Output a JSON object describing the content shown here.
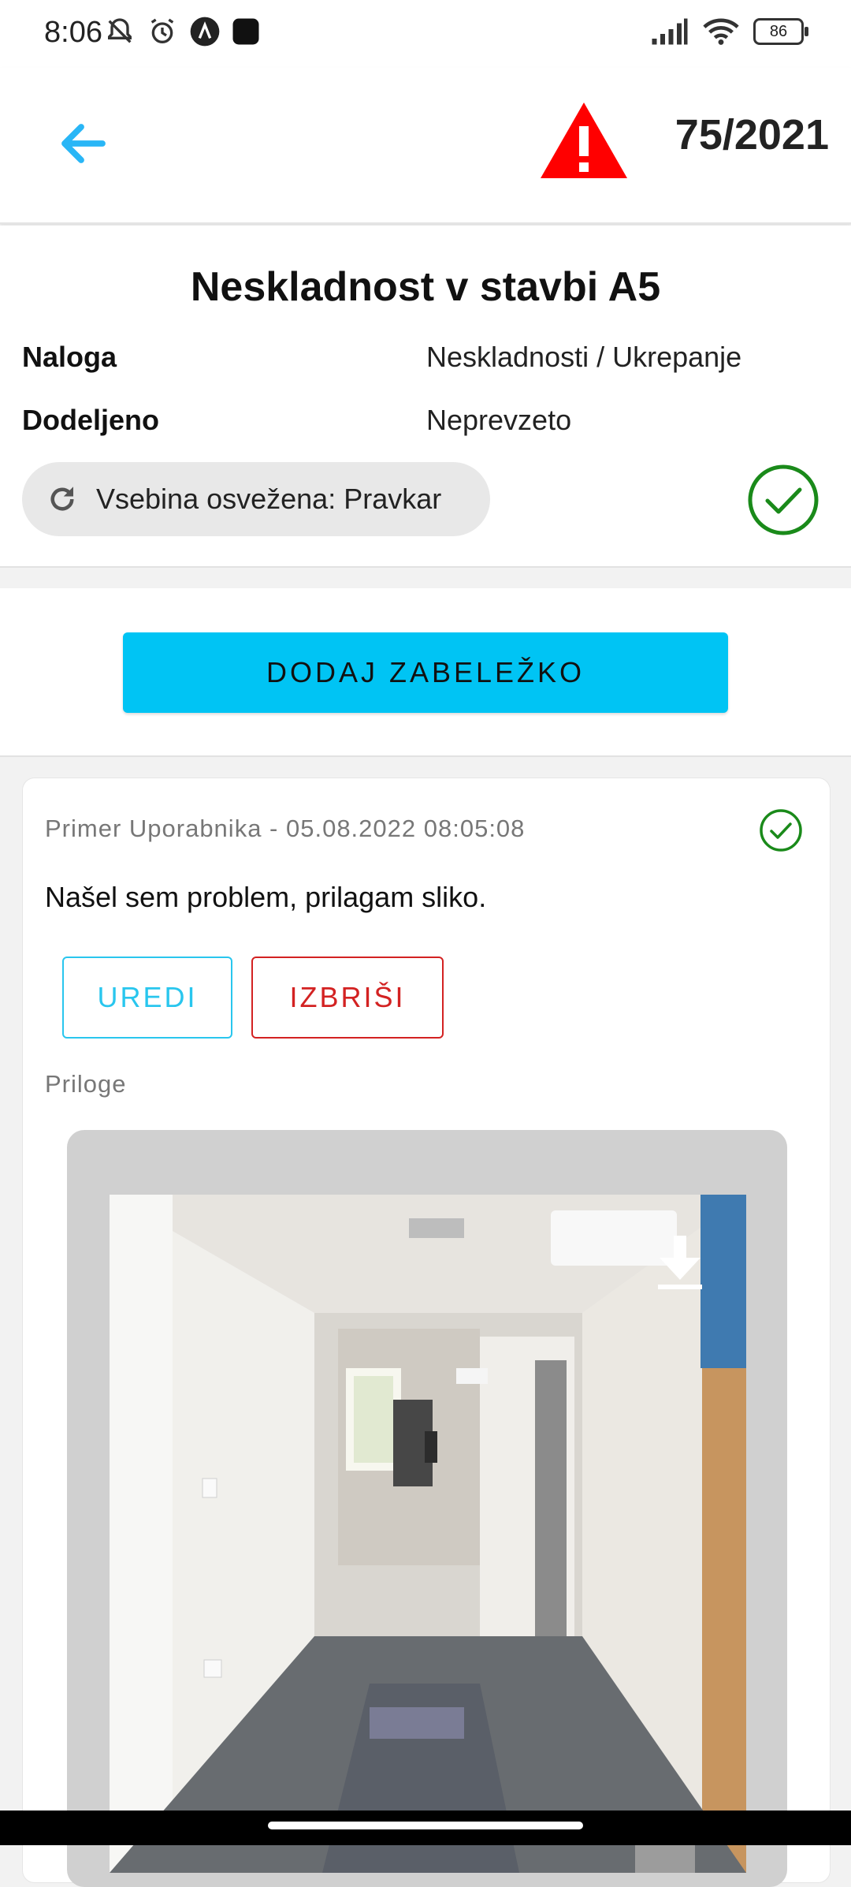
{
  "status_bar": {
    "time": "8:06",
    "battery": "86",
    "icons": [
      "bell-off-icon",
      "alarm-icon",
      "app-a-icon",
      "app-square-icon",
      "signal-icon",
      "wifi-icon",
      "battery-icon"
    ]
  },
  "header": {
    "back_icon": "arrow-left-icon",
    "warning_icon": "warning-triangle-icon",
    "case_number": "75/2021",
    "accent_color": "#29b6f6",
    "warning_color": "#ff0000"
  },
  "details": {
    "title": "Neskladnost v stavbi A5",
    "rows": [
      {
        "label": "Naloga",
        "value": "Neskladnosti / Ukrepanje"
      },
      {
        "label": "Dodeljeno",
        "value": "Neprevzeto"
      }
    ],
    "refresh_text": "Vsebina osvežena: Pravkar",
    "status_icon": "check-circle-icon",
    "status_color": "#1a8a1a"
  },
  "actions": {
    "add_note_label": "DODAJ ZABELEŽKO",
    "button_color": "#00c4f4"
  },
  "note": {
    "meta": "Primer Uporabnika - 05.08.2022 08:05:08",
    "text": "Našel sem problem, prilagam sliko.",
    "edit_label": "UREDI",
    "delete_label": "IZBRIŠI",
    "attachments_label": "Priloge",
    "download_icon": "download-icon"
  }
}
